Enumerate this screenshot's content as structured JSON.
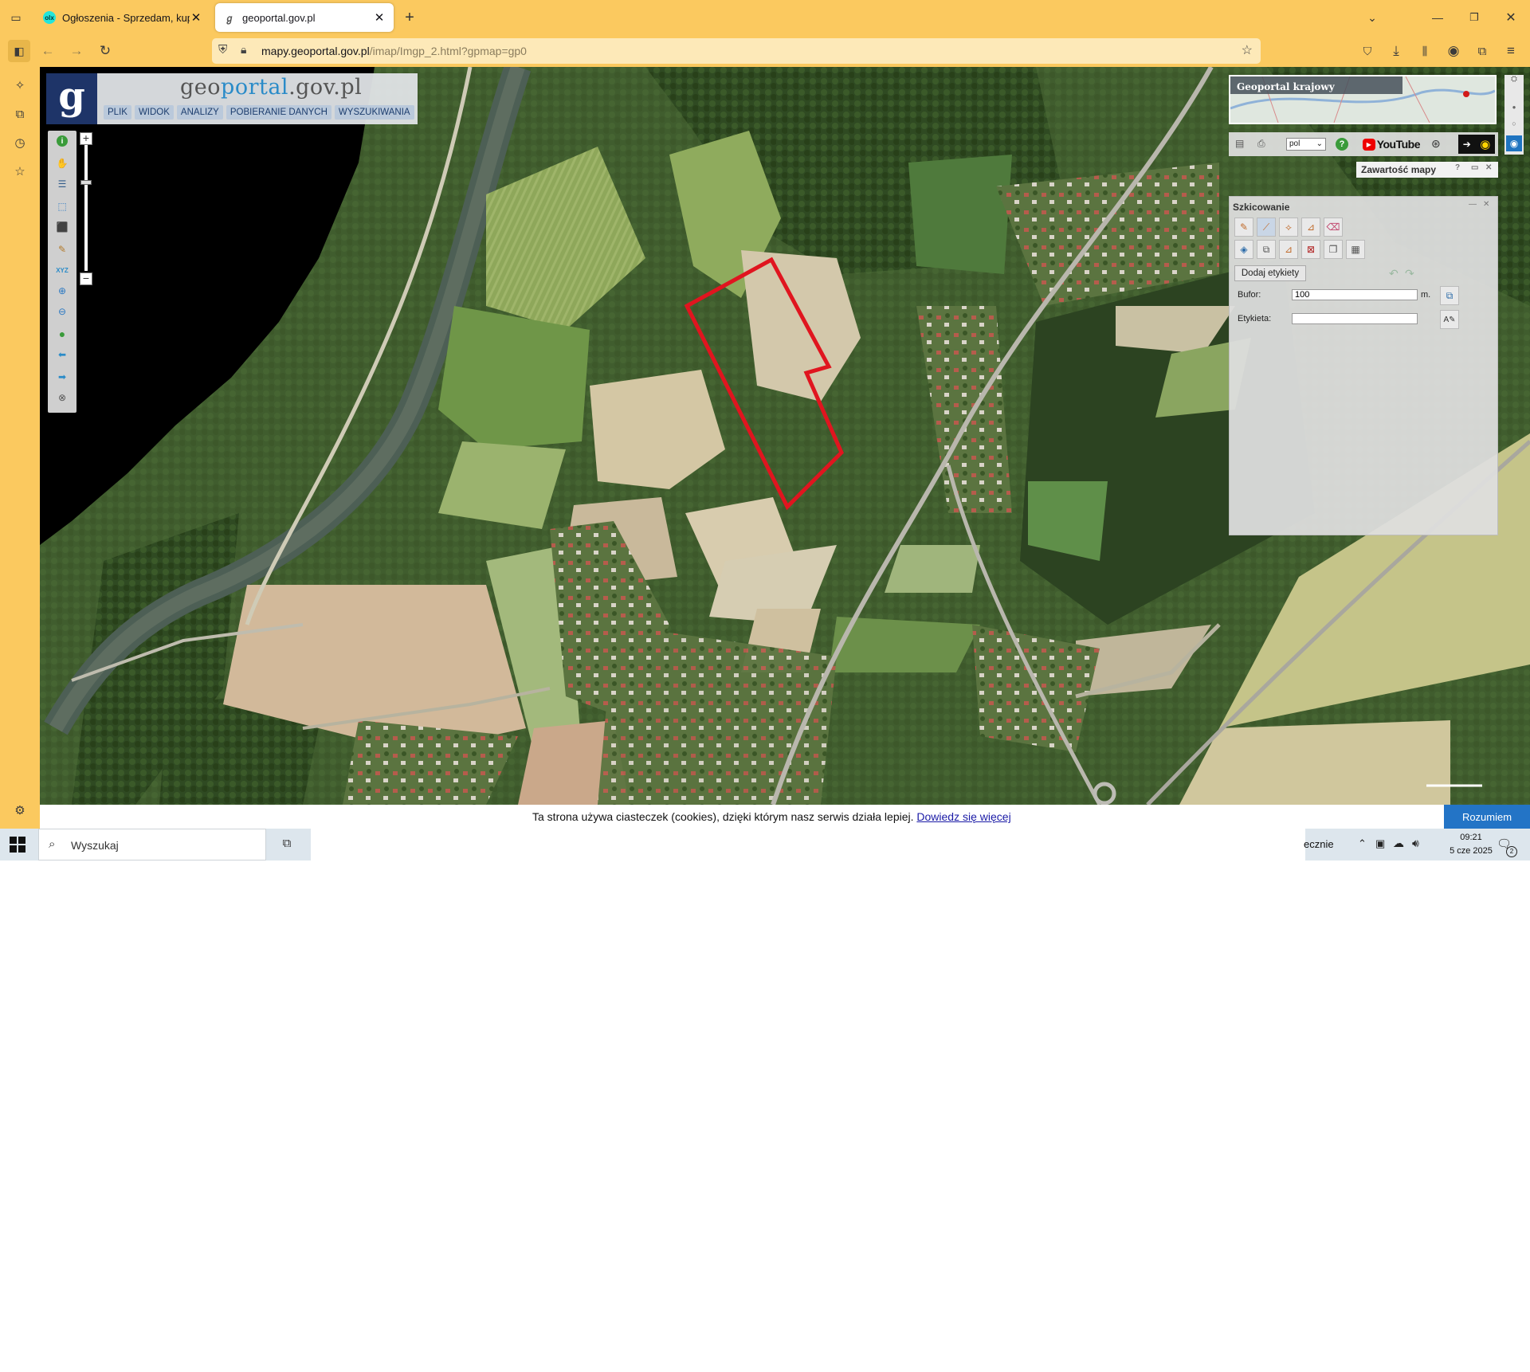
{
  "browser": {
    "tabs": [
      {
        "title": "Ogłoszenia - Sprzedam, kupię n",
        "favicon": "olx-icon",
        "active": false
      },
      {
        "title": "geoportal.gov.pl",
        "favicon": "geoportal-icon",
        "active": true
      }
    ],
    "url_host": "mapy.geoportal.gov.pl",
    "url_path": "/imap/Imgp_2.html?gpmap=gp0"
  },
  "geoportal": {
    "logo_letter": "g",
    "title_pre": "geo",
    "title_mid": "portal",
    "title_post": ".gov.pl",
    "menu": [
      "PLIK",
      "WIDOK",
      "ANALIZY",
      "POBIERANIE DANYCH",
      "WYSZUKIWANIA"
    ],
    "overview_title": "Geoportal krajowy",
    "language": "pol",
    "youtube_label": "YouTube",
    "content_panel_title": "Zawartość mapy"
  },
  "sketch_panel": {
    "title": "Szkicowanie",
    "add_labels": "Dodaj etykiety",
    "buffer_label": "Bufor:",
    "buffer_value": "100",
    "buffer_unit": "m.",
    "label_label": "Etykieta:",
    "label_value": ""
  },
  "cookie": {
    "text": "Ta strona używa ciasteczek (cookies), dzięki którym nasz serwis działa lepiej.",
    "link": "Dowiedz się więcej",
    "accept": "Rozumiem"
  },
  "taskbar": {
    "search_placeholder": "Wyszukaj",
    "weather_partial": "ecznie",
    "time": "09:21",
    "date": "5 cze 2025",
    "notifications": "2"
  },
  "colors": {
    "browser_chrome": "#fbc95f",
    "parcel_outline": "#e0151f",
    "accept_button": "#2374c6"
  }
}
